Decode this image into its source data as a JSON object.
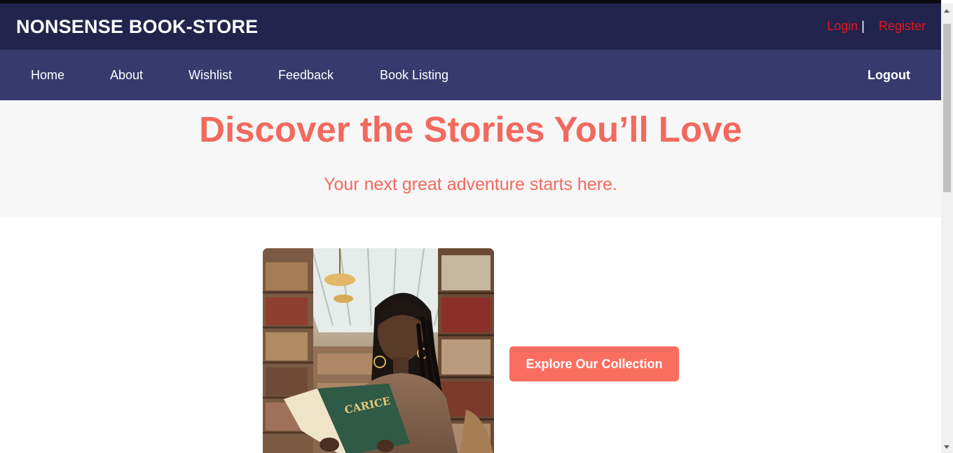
{
  "header": {
    "brand": "NONSENSE BOOK-STORE",
    "login_label": "Login",
    "separator": "|",
    "register_label": "Register"
  },
  "nav": {
    "items": [
      {
        "label": "Home"
      },
      {
        "label": "About"
      },
      {
        "label": "Wishlist"
      },
      {
        "label": "Feedback"
      },
      {
        "label": "Book Listing"
      }
    ],
    "logout_label": "Logout"
  },
  "hero": {
    "title": "Discover the Stories You’ll Love",
    "subtitle": "Your next great adventure starts here."
  },
  "main": {
    "cta_label": "Explore Our Collection",
    "image_subject": "woman-reading-in-library",
    "book_cover_text": "CARICE"
  },
  "colors": {
    "header_bg": "#22244d",
    "nav_bg": "#383a6d",
    "accent": "#f2695e",
    "button_bg": "#fa6e60",
    "auth_link": "#e8141b"
  }
}
